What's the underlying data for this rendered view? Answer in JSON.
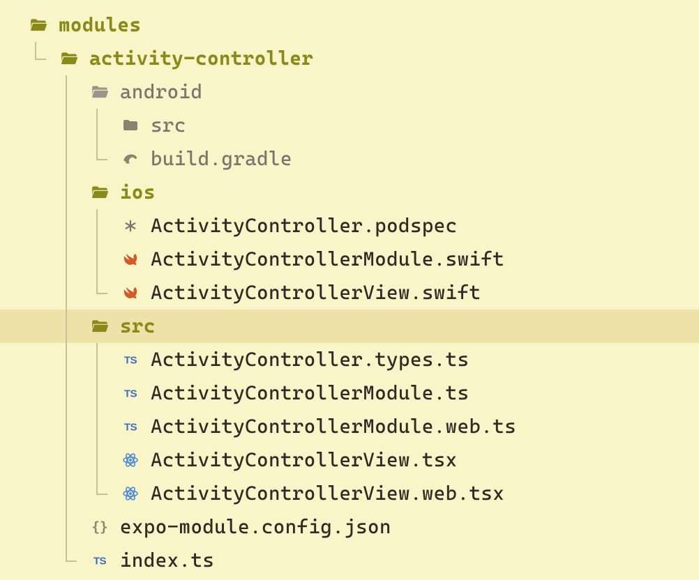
{
  "colors": {
    "bg": "#faf5c8",
    "selected": "#ede3a8",
    "guide": "#c7c19a",
    "olive": "#8a8a1a",
    "gray": "#7a766d",
    "black": "#2e2a24",
    "swift": "#d15a2a",
    "ts": "#3e6fbf",
    "react": "#4a8bd6",
    "json": "#8c8674"
  },
  "tree": {
    "root": "modules",
    "activityController": "activity-controller",
    "android": "android",
    "androidSrc": "src",
    "buildGradle": "build.gradle",
    "ios": "ios",
    "podspec": "ActivityController.podspec",
    "moduleSwift": "ActivityControllerModule.swift",
    "viewSwift": "ActivityControllerView.swift",
    "src": "src",
    "typesTs": "ActivityController.types.ts",
    "moduleTs": "ActivityControllerModule.ts",
    "moduleWebTs": "ActivityControllerModule.web.ts",
    "viewTsx": "ActivityControllerView.tsx",
    "viewWebTsx": "ActivityControllerView.web.tsx",
    "expoConfig": "expo-module.config.json",
    "indexTs": "index.ts"
  }
}
